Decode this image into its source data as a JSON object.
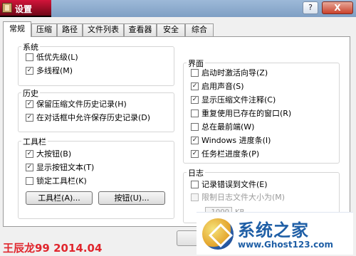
{
  "window": {
    "title": "设置"
  },
  "titlebar": {
    "help_symbol": "?",
    "close_symbol": "X"
  },
  "tabs": [
    "常规",
    "压缩",
    "路径",
    "文件列表",
    "查看器",
    "安全",
    "综合"
  ],
  "active_tab": "常规",
  "groups": {
    "system": {
      "title": "系统",
      "options": [
        {
          "label": "低优先级(L)",
          "checked": false
        },
        {
          "label": "多线程(M)",
          "checked": true
        }
      ]
    },
    "history": {
      "title": "历史",
      "options": [
        {
          "label": "保留压缩文件历史记录(H)",
          "checked": true
        },
        {
          "label": "在对话框中允许保存历史记录(D)",
          "checked": true
        }
      ]
    },
    "toolbar": {
      "title": "工具栏",
      "options": [
        {
          "label": "大按钮(B)",
          "checked": true
        },
        {
          "label": "显示按钮文本(T)",
          "checked": true
        },
        {
          "label": "锁定工具栏(K)",
          "checked": false
        }
      ],
      "buttons": [
        "工具栏(A)...",
        "按钮(U)..."
      ]
    },
    "interface": {
      "title": "界面",
      "options": [
        {
          "label": "启动时激活向导(Z)",
          "checked": false
        },
        {
          "label": "启用声音(S)",
          "checked": true
        },
        {
          "label": "显示压缩文件注释(C)",
          "checked": true
        },
        {
          "label": "重复使用已存在的窗口(R)",
          "checked": false
        },
        {
          "label": "总在最前端(W)",
          "checked": false
        },
        {
          "label": "Windows 进度条(I)",
          "checked": true
        },
        {
          "label": "任务栏进度条(P)",
          "checked": true
        }
      ]
    },
    "log": {
      "title": "日志",
      "options": [
        {
          "label": "记录错误到文件(E)",
          "checked": false,
          "disabled": false
        },
        {
          "label": "限制日志文件大小为(M)",
          "checked": false,
          "disabled": true
        }
      ],
      "size_value": "1000",
      "size_unit": "KB"
    }
  },
  "watermark": {
    "author_text": "王辰龙99 2014.04",
    "logo_text": "系统之家",
    "logo_url": "www.Ghost123.com"
  }
}
